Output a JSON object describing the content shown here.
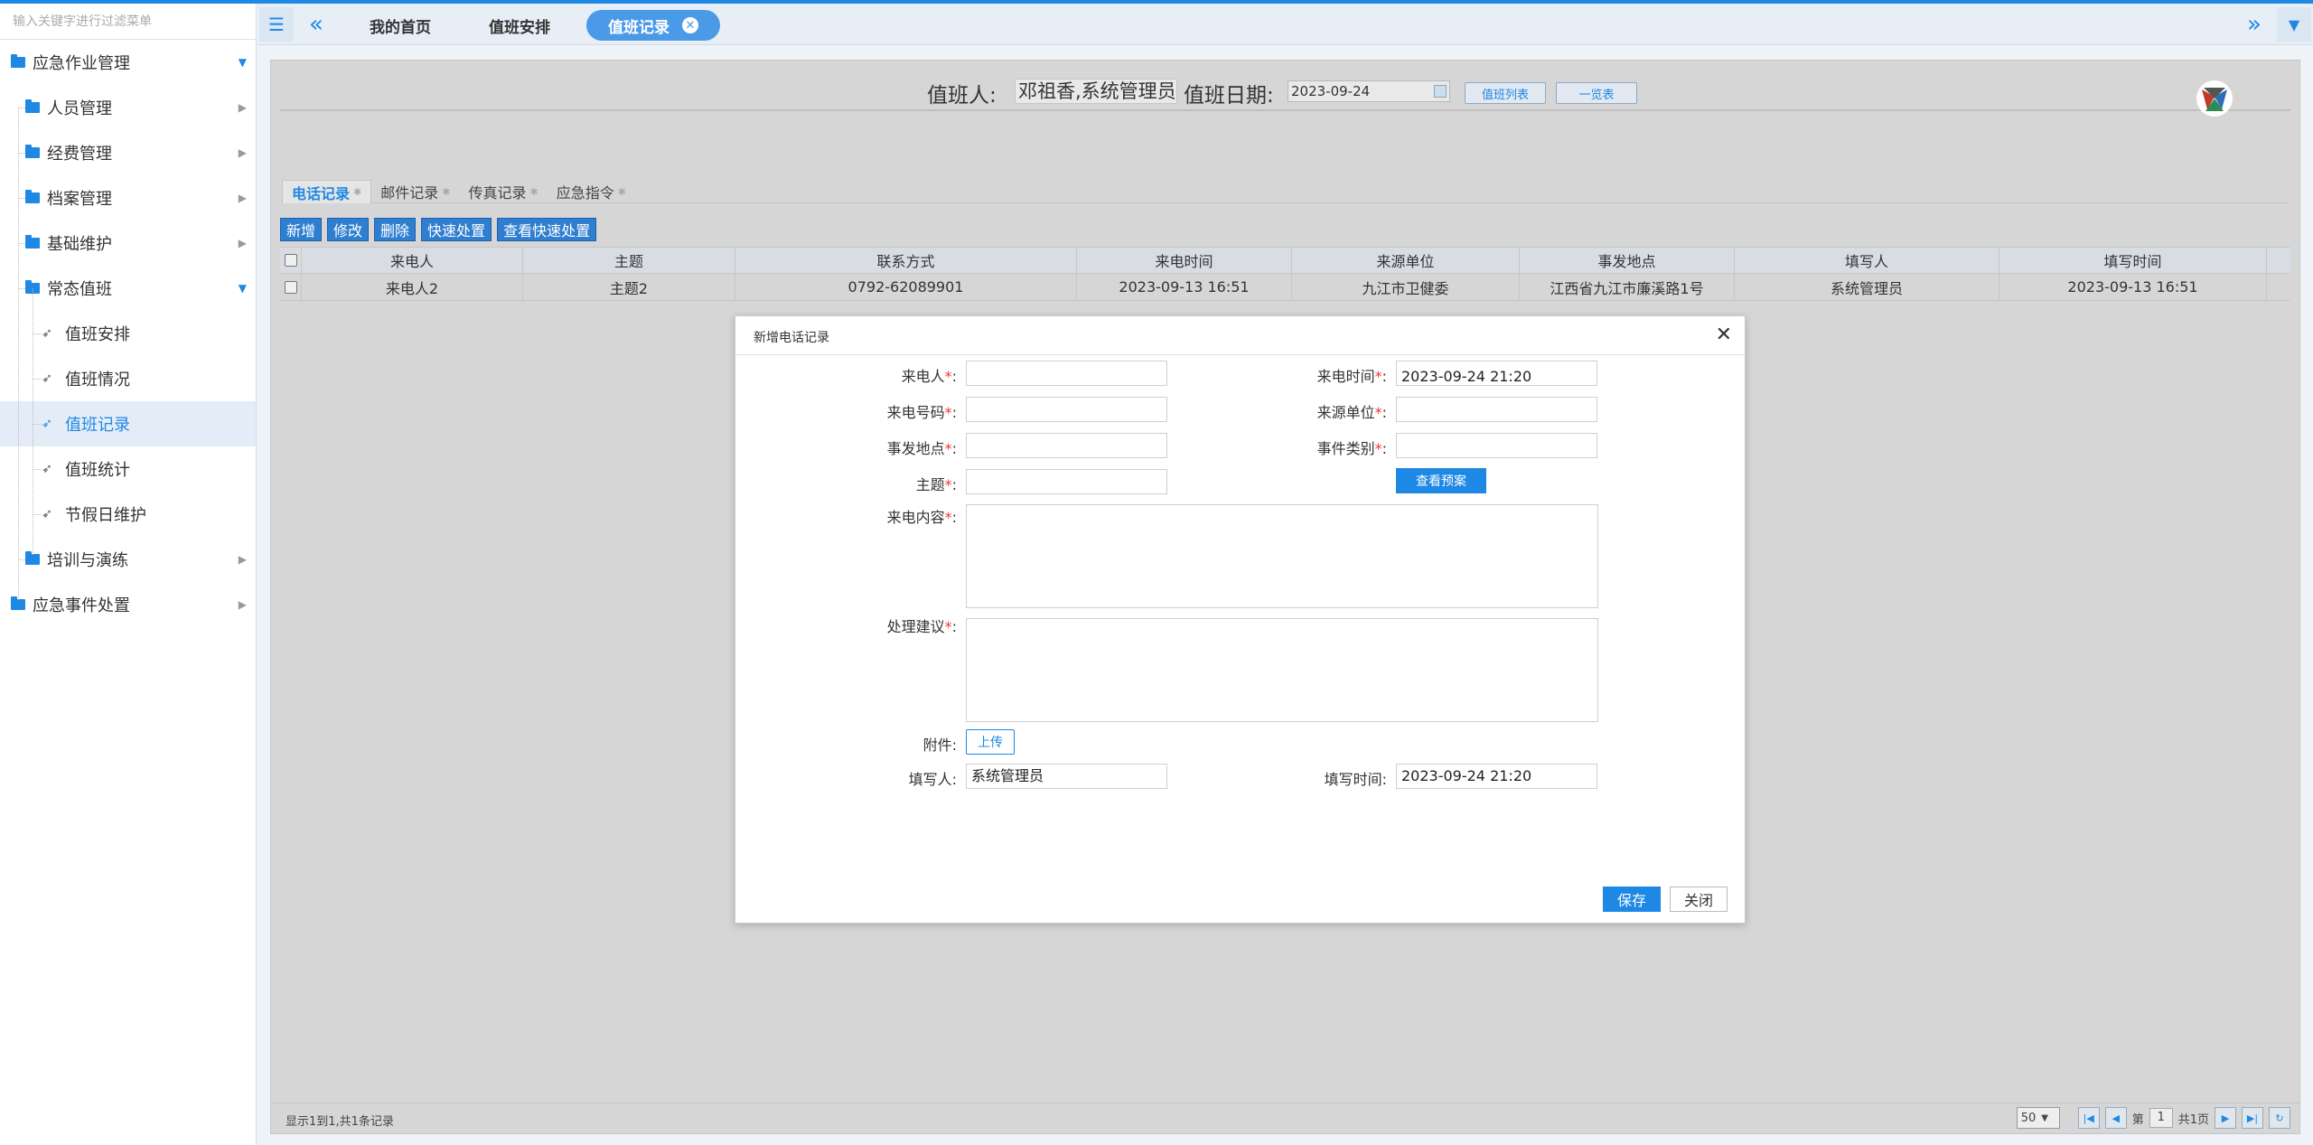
{
  "colors": {
    "accent": "#1e88e5",
    "active_tab": "#4a9ae8",
    "required": "#ee3333"
  },
  "sidebar": {
    "filter_placeholder": "输入关键字进行过滤菜单",
    "items": [
      {
        "label": "应急作业管理",
        "level": 0,
        "icon": "folder-icon",
        "expanded": true
      },
      {
        "label": "人员管理",
        "level": 1,
        "icon": "folder-icon"
      },
      {
        "label": "经费管理",
        "level": 1,
        "icon": "folder-icon"
      },
      {
        "label": "档案管理",
        "level": 1,
        "icon": "folder-icon"
      },
      {
        "label": "基础维护",
        "level": 1,
        "icon": "folder-icon"
      },
      {
        "label": "常态值班",
        "level": 1,
        "icon": "folder-icon",
        "expanded": true
      },
      {
        "label": "值班安排",
        "level": 2,
        "icon": "paper-plane-icon"
      },
      {
        "label": "值班情况",
        "level": 2,
        "icon": "paper-plane-icon"
      },
      {
        "label": "值班记录",
        "level": 2,
        "icon": "paper-plane-icon",
        "active": true
      },
      {
        "label": "值班统计",
        "level": 2,
        "icon": "paper-plane-icon"
      },
      {
        "label": "节假日维护",
        "level": 2,
        "icon": "paper-plane-icon"
      },
      {
        "label": "培训与演练",
        "level": 1,
        "icon": "folder-icon"
      },
      {
        "label": "应急事件处置",
        "level": 0,
        "icon": "folder-icon"
      }
    ]
  },
  "header": {
    "tabs": [
      {
        "label": "我的首页"
      },
      {
        "label": "值班安排"
      },
      {
        "label": "值班记录",
        "active": true
      }
    ]
  },
  "duty": {
    "person_label": "值班人:",
    "person_value": "邓祖香,系统管理员",
    "date_label": "值班日期:",
    "date_value": "2023-09-24",
    "list_button": "值班列表",
    "overview_button": "一览表"
  },
  "subtabs": [
    {
      "label": "电话记录",
      "active": true
    },
    {
      "label": "邮件记录"
    },
    {
      "label": "传真记录"
    },
    {
      "label": "应急指令"
    }
  ],
  "toolbar": {
    "add": "新增",
    "edit": "修改",
    "delete": "删除",
    "quick": "快速处置",
    "view_quick": "查看快速处置"
  },
  "table": {
    "columns": [
      "来电人",
      "主题",
      "联系方式",
      "来电时间",
      "来源单位",
      "事发地点",
      "填写人",
      "填写时间"
    ],
    "rows": [
      [
        "来电人2",
        "主题2",
        "0792-62089901",
        "2023-09-13 16:51",
        "九江市卫健委",
        "江西省九江市廉溪路1号",
        "系统管理员",
        "2023-09-13 16:51"
      ]
    ]
  },
  "footer": {
    "summary": "显示1到1,共1条记录",
    "page_size": "50",
    "page_prefix": "第",
    "page_number": "1",
    "page_total": "共1页"
  },
  "dialog": {
    "title": "新增电话记录",
    "caller_label": "来电人",
    "call_time_label": "来电时间",
    "call_time_value": "2023-09-24 21:20",
    "phone_label": "来电号码",
    "source_label": "来源单位",
    "location_label": "事发地点",
    "event_type_label": "事件类别",
    "subject_label": "主题",
    "view_plan_button": "查看预案",
    "content_label": "来电内容",
    "suggestion_label": "处理建议",
    "attachment_label": "附件:",
    "upload_button": "上传",
    "writer_label": "填写人:",
    "writer_value": "系统管理员",
    "write_time_label": "填写时间:",
    "write_time_value": "2023-09-24 21:20",
    "save_button": "保存",
    "close_button": "关闭",
    "required_mark": "*",
    "colon": ":"
  }
}
